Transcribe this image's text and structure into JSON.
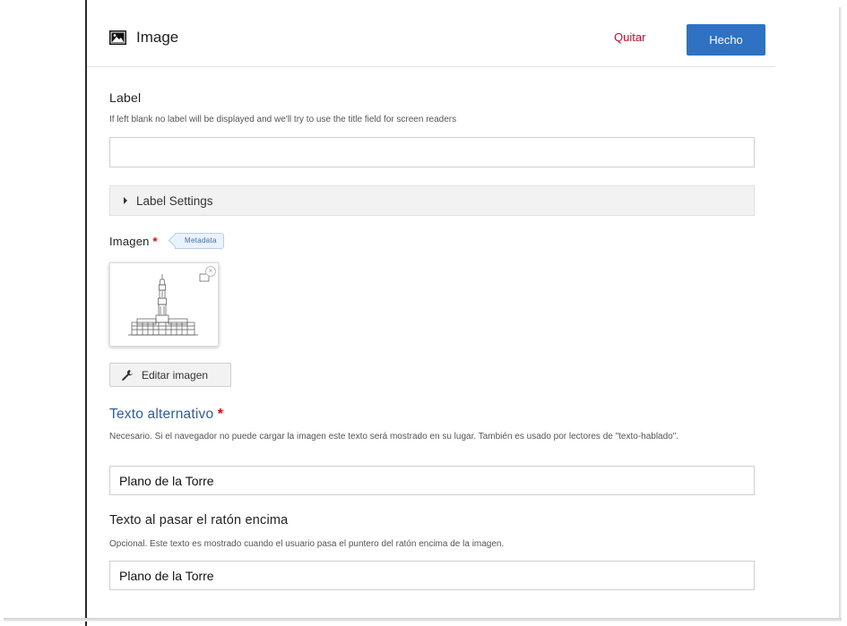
{
  "header": {
    "title": "Image",
    "icon": "image-icon",
    "remove_label": "Quitar",
    "done_label": "Hecho"
  },
  "label_section": {
    "label": "Label",
    "description": "If left blank no label will be displayed and we'll try to use the title field for screen readers",
    "value": ""
  },
  "label_settings": {
    "label": "Label Settings"
  },
  "image_section": {
    "label": "Imagen",
    "required_mark": "*",
    "metadata_badge": "Metadata",
    "remove_icon": "close-icon",
    "edit_button_label": "Editar imagen",
    "edit_icon": "wrench-icon"
  },
  "alt_text": {
    "label": "Texto alternativo",
    "required_mark": "*",
    "description": "Necesario. Si el navegador no puede cargar la imagen este texto será mostrado en su lugar. También es usado por lectores de \"texto-hablado\".",
    "value": "Plano de la Torre"
  },
  "hover_text": {
    "label": "Texto al pasar el ratón encima",
    "description": "Opcional. Este texto es mostrado cuando el usuario pasa el puntero del ratón encima de la imagen.",
    "value": "Plano de la Torre"
  },
  "colors": {
    "accent": "#2f72c4",
    "danger": "#c8102e",
    "heading_blue": "#2b5ea7",
    "required": "#e00000"
  }
}
